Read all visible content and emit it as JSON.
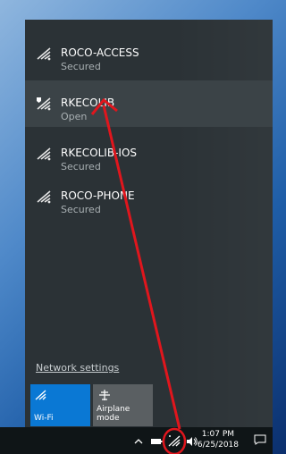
{
  "networks": [
    {
      "name": "ROCO-ACCESS",
      "status": "Secured"
    },
    {
      "name": "RKECOLIB",
      "status": "Open"
    },
    {
      "name": "RKECOLIB-IOS",
      "status": "Secured"
    },
    {
      "name": "ROCO-PHONE",
      "status": "Secured"
    }
  ],
  "network_settings_label": "Network settings",
  "tiles": [
    {
      "label": "Wi-Fi",
      "icon": "wifi-icon",
      "active": true
    },
    {
      "label": "Airplane mode",
      "icon": "airplane-icon",
      "active": false
    }
  ],
  "taskbar": {
    "time": "1:07 PM",
    "date": "6/25/2018"
  },
  "colors": {
    "accent": "#0a78d4",
    "annotation": "#e0161d"
  }
}
